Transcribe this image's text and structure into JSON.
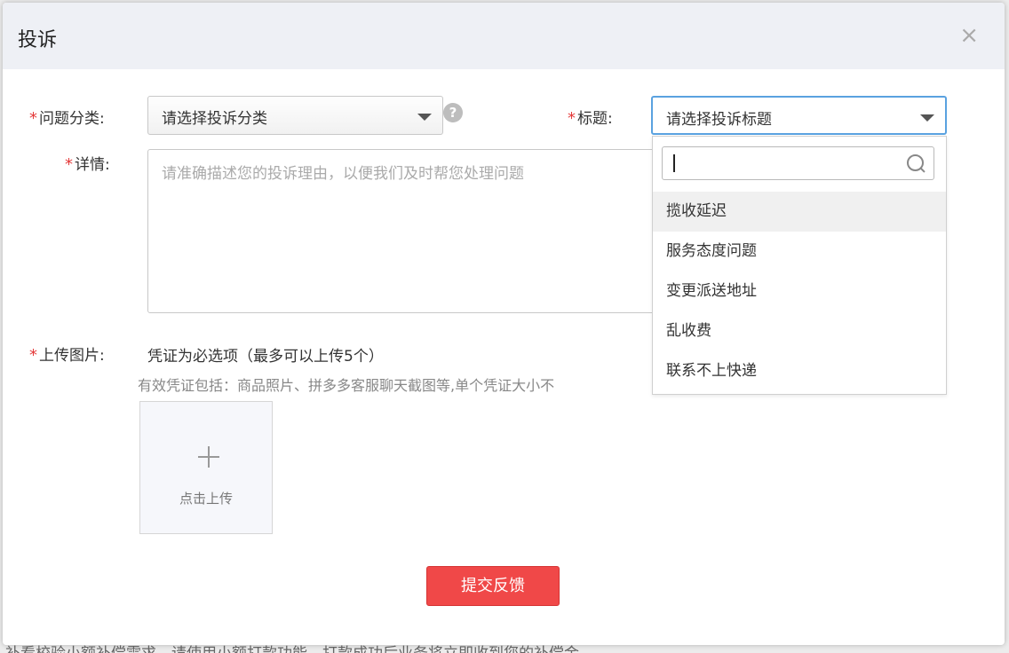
{
  "background": {
    "text": "补看校验小额补偿需求，请使用小额打款功能，打款成功后业务将立即收到您的补偿金"
  },
  "dialog": {
    "title": "投诉",
    "close": "×"
  },
  "form": {
    "required_mark": "*",
    "category_label": "问题分类:",
    "category_placeholder": "请选择投诉分类",
    "help": "?",
    "title_label": "标题:",
    "title_placeholder": "请选择投诉标题",
    "detail_label": "详情:",
    "detail_placeholder": "请准确描述您的投诉理由，以便我们及时帮您处理问题",
    "upload_label": "上传图片:",
    "upload_hint": "凭证为必选项（最多可以上传5个）",
    "upload_desc": "有效凭证包括：商品照片、拼多多客服聊天截图等,单个凭证大小不",
    "upload_button": "点击上传",
    "submit": "提交反馈"
  },
  "dropdown": {
    "search_value": "",
    "items": [
      "揽收延迟",
      "服务态度问题",
      "变更派送地址",
      "乱收费",
      "联系不上快递"
    ],
    "highlighted_index": 0
  }
}
